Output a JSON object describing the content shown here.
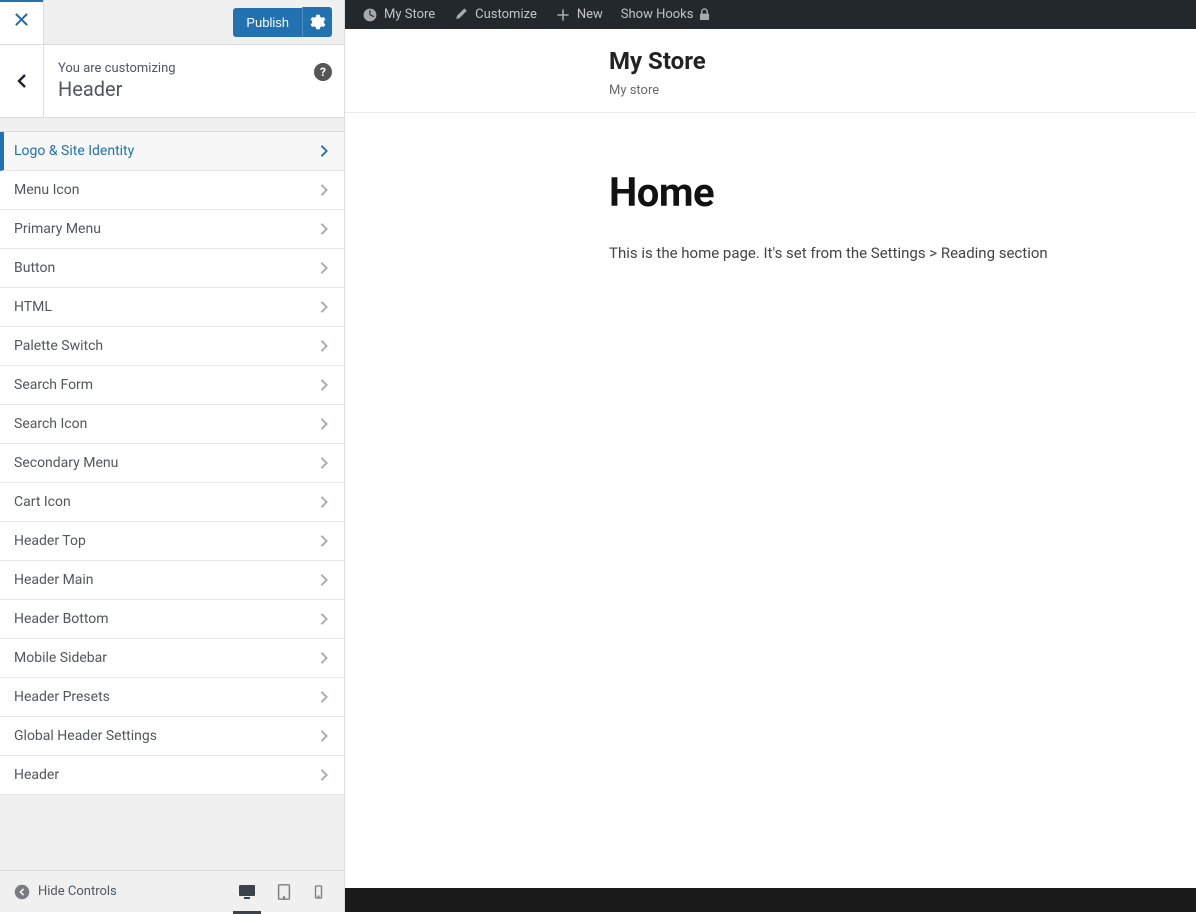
{
  "sidebar": {
    "publish_label": "Publish",
    "customizing_label": "You are customizing",
    "section_title": "Header",
    "hide_controls_label": "Hide Controls",
    "items": [
      {
        "label": "Logo & Site Identity",
        "active": true
      },
      {
        "label": "Menu Icon",
        "active": false
      },
      {
        "label": "Primary Menu",
        "active": false
      },
      {
        "label": "Button",
        "active": false
      },
      {
        "label": "HTML",
        "active": false
      },
      {
        "label": "Palette Switch",
        "active": false
      },
      {
        "label": "Search Form",
        "active": false
      },
      {
        "label": "Search Icon",
        "active": false
      },
      {
        "label": "Secondary Menu",
        "active": false
      },
      {
        "label": "Cart Icon",
        "active": false
      },
      {
        "label": "Header Top",
        "active": false
      },
      {
        "label": "Header Main",
        "active": false
      },
      {
        "label": "Header Bottom",
        "active": false
      },
      {
        "label": "Mobile Sidebar",
        "active": false
      },
      {
        "label": "Header Presets",
        "active": false
      },
      {
        "label": "Global Header Settings",
        "active": false
      },
      {
        "label": "Header",
        "active": false
      }
    ]
  },
  "adminbar": {
    "site_name": "My Store",
    "customize": "Customize",
    "new": "New",
    "show_hooks": "Show Hooks"
  },
  "preview": {
    "site_title": "My Store",
    "site_tagline": "My store",
    "page_title": "Home",
    "page_body": "This is the home page. It's set from the Settings > Reading section"
  }
}
